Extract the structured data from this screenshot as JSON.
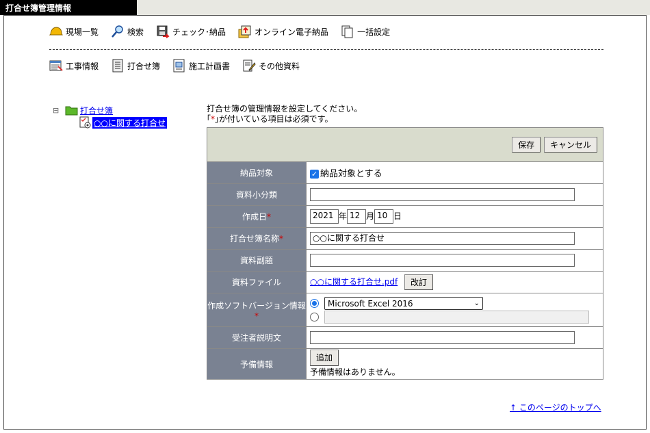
{
  "window": {
    "title": "打合せ簿管理情報"
  },
  "nav1": [
    {
      "label": "現場一覧",
      "icon": "helmet-icon"
    },
    {
      "label": "検索",
      "icon": "magnifier-icon"
    },
    {
      "label": "チェック･納品",
      "icon": "floppy-check-icon"
    },
    {
      "label": "オンライン電子納品",
      "icon": "online-delivery-icon"
    },
    {
      "label": "一括設定",
      "icon": "documents-icon"
    }
  ],
  "nav2": [
    {
      "label": "工事情報",
      "icon": "construction-info-icon"
    },
    {
      "label": "打合せ簿",
      "icon": "meeting-book-icon"
    },
    {
      "label": "施工計画書",
      "icon": "plan-document-icon"
    },
    {
      "label": "その他資料",
      "icon": "other-document-icon"
    }
  ],
  "tree": {
    "toggle": "⊟",
    "root_label": "打合せ簿",
    "child_label": "○○に関する打合せ"
  },
  "instructions": {
    "line1": "打合せ簿の管理情報を設定してください。",
    "line2_open": "｢",
    "line2_mark": "*",
    "line2_rest": "｣が付いている項目は必須です。"
  },
  "toolbar": {
    "save_label": "保存",
    "cancel_label": "キャンセル"
  },
  "required_mark": "*",
  "form": {
    "delivery_target": {
      "label": "納品対象",
      "checkbox_label": "納品対象とする",
      "checked": true
    },
    "subcategory": {
      "label": "資料小分類",
      "value": ""
    },
    "created_date": {
      "label": "作成日",
      "year": "2021",
      "year_unit": "年",
      "month": "12",
      "month_unit": "月",
      "day": "10",
      "day_unit": "日"
    },
    "book_name": {
      "label": "打合せ簿名称",
      "value": "○○に関する打合せ"
    },
    "subtitle": {
      "label": "資料副題",
      "value": ""
    },
    "file": {
      "label": "資料ファイル",
      "link": "○○に関する打合せ.pdf",
      "button": "改訂"
    },
    "software": {
      "label": "作成ソフトバージョン情報",
      "selected": "Microsoft Excel 2016",
      "other_value": ""
    },
    "description": {
      "label": "受注者説明文",
      "value": ""
    },
    "reserve": {
      "label": "予備情報",
      "button": "追加",
      "empty_text": "予備情報はありません。"
    }
  },
  "page_top_link": "↑ このページのトップへ",
  "colors": {
    "header_cell": "#7a8292",
    "toolbar_bg": "#d9dccd",
    "link": "#0000ee",
    "required": "#cc0000"
  }
}
